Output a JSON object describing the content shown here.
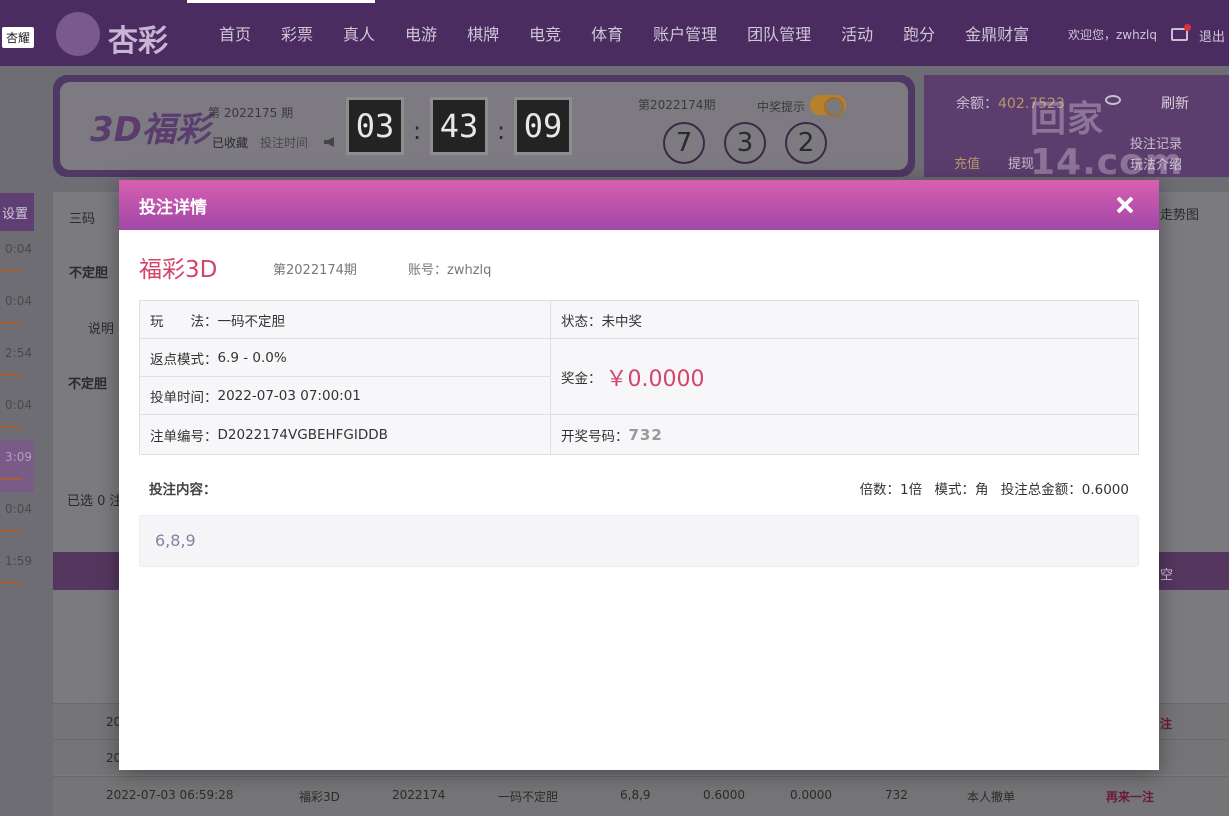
{
  "topbar": {
    "badge": "杏耀",
    "logo_text": "杏彩",
    "nav": [
      "首页",
      "彩票",
      "真人",
      "电游",
      "棋牌",
      "电竞",
      "体育",
      "账户管理",
      "团队管理",
      "活动",
      "跑分",
      "金鼎财富"
    ],
    "welcome": "欢迎您，zwhzlq",
    "logout": "退出"
  },
  "game_panel": {
    "logo": "3D福彩",
    "current_issue": "第 2022175 期",
    "favorite": "已收藏",
    "bet_time_label": "投注时间",
    "timer": [
      "03",
      "43",
      "09"
    ],
    "last_issue": "第2022174期",
    "win_alert": "中奖提示",
    "last_numbers": [
      "7",
      "3",
      "2"
    ]
  },
  "account_panel": {
    "balance_label": "余额：",
    "balance": "402.7523",
    "refresh": "刷新",
    "records": "投注记录",
    "rules": "玩法介绍",
    "recharge": "充值",
    "withdraw": "提现",
    "watermark": "回家14.com"
  },
  "side": {
    "tab": "设置",
    "times": [
      "0:04",
      "0:04",
      "2:54",
      "0:04",
      "3:09",
      "0:04",
      "1:59"
    ]
  },
  "background": {
    "tab_sanma": "三码",
    "budingdan": "不定胆",
    "shuoming": "说明",
    "budingdan2": "不定胆",
    "selected": "已选 0 注",
    "trend": "走势图",
    "clear": "空",
    "row_last": {
      "time": "2022-07-03 06:59:28",
      "game": "福彩3D",
      "issue": "2022174",
      "play": "一码不定胆",
      "content": "6,8,9",
      "amount": "0.6000",
      "prize": "0.0000",
      "draw": "732",
      "status": "本人撤单",
      "action": "再来一注"
    },
    "row_prev_time_1": "20",
    "row_prev_time_2": "20",
    "row_prev_action": "注"
  },
  "modal": {
    "title": "投注详情",
    "game_name": "福彩3D",
    "issue": "第2022174期",
    "account": "账号：zwhzlq",
    "play_label": "玩　　法：",
    "play_value": "一码不定胆",
    "status_label": "状态：",
    "status_value": "未中奖",
    "rebate_label": "返点模式：",
    "rebate_value": "6.9 - 0.0%",
    "prize_label": "奖金：",
    "prize_value": "￥0.0000",
    "time_label": "投单时间：",
    "time_value": "2022-07-03 07:00:01",
    "order_label": "注单编号：",
    "order_value": "D2022174VGBEHFGIDDB",
    "draw_label": "开奖号码：",
    "draw_value": "732",
    "content_label": "投注内容：",
    "multiple": "倍数：1倍",
    "mode": "模式：角",
    "total": "投注总金额：0.6000",
    "numbers": "6,8,9"
  }
}
